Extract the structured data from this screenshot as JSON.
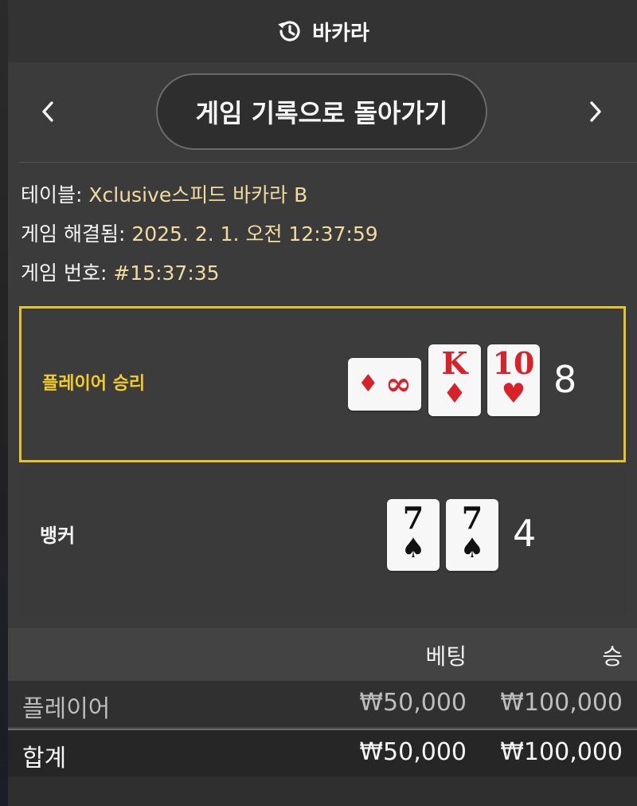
{
  "header": {
    "title": "바카라",
    "icon": "history-icon"
  },
  "nav": {
    "back_label": "게임 기록으로 돌아가기",
    "prev_icon": "chevron-left-icon",
    "next_icon": "chevron-right-icon"
  },
  "info": {
    "table_label": "테이블:",
    "table_value": "Xclusive스피드 바카라 B",
    "resolved_label": "게임 해결됨:",
    "resolved_value": "2025. 2. 1. 오전 12:37:59",
    "game_no_label": "게임 번호:",
    "game_no_value": "#15:37:35"
  },
  "player": {
    "label": "플레이어 승리",
    "score": "8",
    "cards": [
      {
        "rank": "∞",
        "suit": "♦",
        "color": "red",
        "orientation": "side"
      },
      {
        "rank": "K",
        "suit": "♦",
        "color": "red"
      },
      {
        "rank": "10",
        "suit": "♥",
        "color": "red"
      }
    ]
  },
  "banker": {
    "label": "뱅커",
    "score": "4",
    "cards": [
      {
        "rank": "7",
        "suit": "♠",
        "color": "black"
      },
      {
        "rank": "7",
        "suit": "♠",
        "color": "black"
      }
    ]
  },
  "summary": {
    "col_bet": "베팅",
    "col_win": "승",
    "rows": [
      {
        "name": "플레이어",
        "bet": "₩50,000",
        "win": "₩100,000"
      }
    ],
    "total": {
      "name": "합계",
      "bet": "₩50,000",
      "win": "₩100,000"
    }
  },
  "colors": {
    "accent_gold": "#e4c42a",
    "value_text": "#f0dca0",
    "card_red": "#d9212a"
  }
}
